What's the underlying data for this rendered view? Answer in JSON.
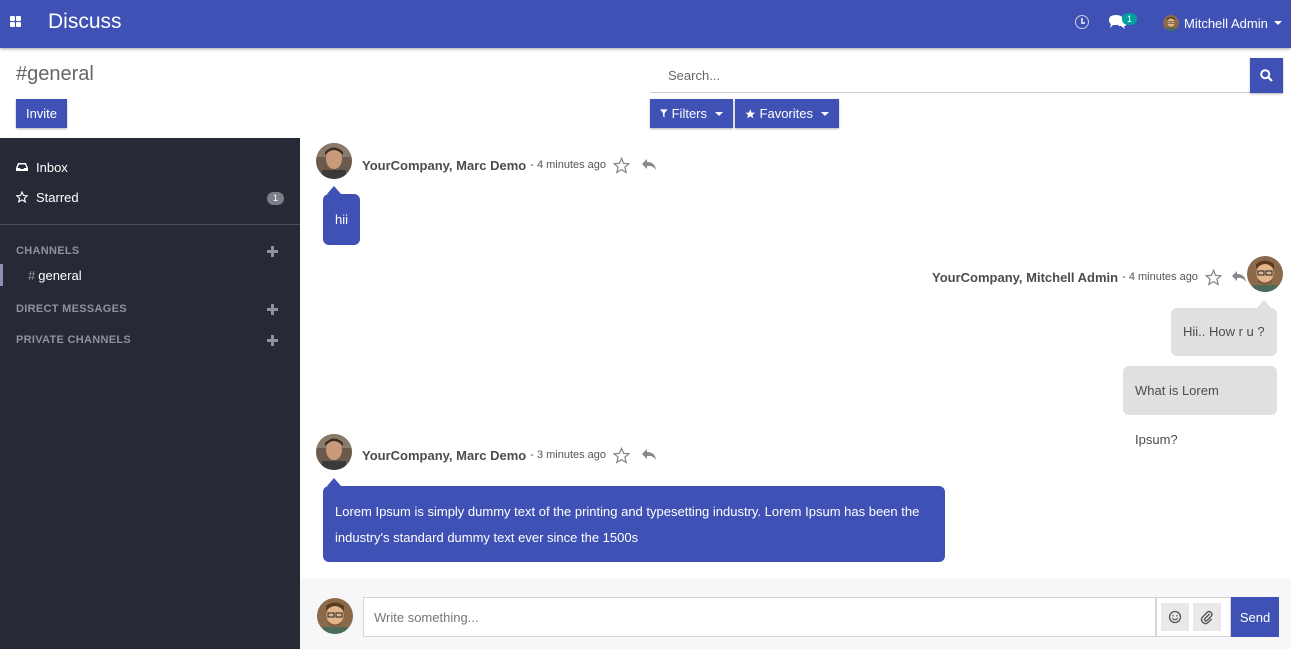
{
  "navbar": {
    "app_title": "Discuss",
    "chat_count": "1",
    "user_name": "Mitchell Admin"
  },
  "control_panel": {
    "title": "#general",
    "invite_label": "Invite",
    "search_placeholder": "Search...",
    "filters_label": "Filters",
    "favorites_label": "Favorites"
  },
  "sidebar": {
    "inbox_label": "Inbox",
    "starred_label": "Starred",
    "starred_count": "1",
    "channels_header": "CHANNELS",
    "channel_hash": "#",
    "active_channel": "general",
    "direct_messages_header": "DIRECT MESSAGES",
    "private_channels_header": "PRIVATE CHANNELS"
  },
  "messages": [
    {
      "author": "YourCompany, Marc Demo",
      "date": "- 4 minutes ago",
      "text": "hii",
      "side": "left"
    },
    {
      "author": "YourCompany, Mitchell Admin",
      "date": "- 4 minutes ago",
      "texts": [
        "Hii.. How r u ?",
        "What is Lorem Ipsum?"
      ],
      "side": "right"
    },
    {
      "author": "YourCompany, Marc Demo",
      "date": "- 3 minutes ago",
      "text_line1": "Lorem Ipsum is simply dummy text of the printing and typesetting industry. Lorem Ipsum has been the",
      "text_line2": "industry's standard dummy text ever since the 1500s",
      "side": "left"
    }
  ],
  "composer": {
    "placeholder": "Write something...",
    "send_label": "Send"
  },
  "colors": {
    "primary": "#3f51b5",
    "sidebar_bg": "#262a36",
    "badge_teal": "#00a09d"
  }
}
